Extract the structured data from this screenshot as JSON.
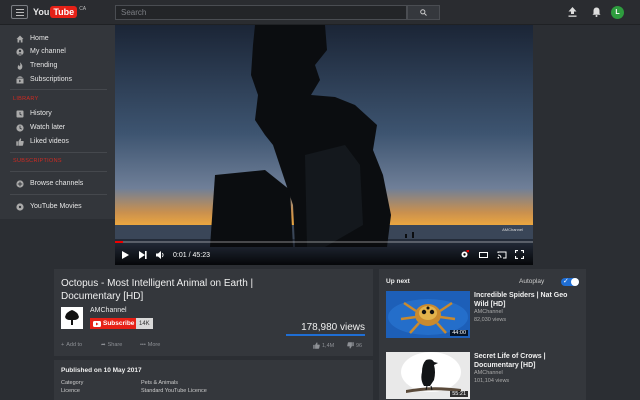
{
  "topbar": {
    "logo_you": "You",
    "logo_tube": "Tube",
    "logo_country": "CA",
    "search_placeholder": "Search",
    "avatar_initial": "L"
  },
  "sidebar": {
    "items_top": [
      {
        "label": "Home",
        "icon": "home-icon"
      },
      {
        "label": "My channel",
        "icon": "person-icon"
      },
      {
        "label": "Trending",
        "icon": "flame-icon"
      },
      {
        "label": "Subscriptions",
        "icon": "subscriptions-icon"
      }
    ],
    "library_heading": "LIBRARY",
    "items_library": [
      {
        "label": "History",
        "icon": "history-icon"
      },
      {
        "label": "Watch later",
        "icon": "clock-icon"
      },
      {
        "label": "Liked videos",
        "icon": "thumbs-up-icon"
      }
    ],
    "subscriptions_heading": "SUBSCRIPTIONS",
    "items_bottom": [
      {
        "label": "Browse channels",
        "icon": "plus-circle-icon"
      },
      {
        "label": "YouTube Movies",
        "icon": "film-icon"
      }
    ]
  },
  "player": {
    "time_current": "0:01",
    "time_total": "45:23",
    "time_separator": "/",
    "progress_fraction": 0.02,
    "watermark": "AMChannel"
  },
  "video": {
    "title": "Octopus - Most Intelligent Animal on Earth | Documentary [HD]",
    "channel": "AMChannel",
    "subscribe_label": "Subscribe",
    "subscriber_count": "14K",
    "views": "178,980 views",
    "actions": {
      "add_to": "Add to",
      "share": "Share",
      "more": "More",
      "like": "1,4M",
      "dislike": "96"
    },
    "published": "Published on 10 May 2017",
    "meta": [
      {
        "key": "Category",
        "value": "Pets & Animals"
      },
      {
        "key": "Licence",
        "value": "Standard YouTube Licence"
      }
    ]
  },
  "upnext": {
    "label": "Up next",
    "autoplay_label": "Autoplay",
    "autoplay_on": true,
    "items": [
      {
        "title": "Incredible Spiders | Nat Geo Wild [HD]",
        "channel": "AMChannel",
        "views": "82,030 views",
        "duration": "44:00"
      },
      {
        "title": "Secret Life of Crows | Documentary [HD]",
        "channel": "AMChannel",
        "views": "101,104 views",
        "duration": "55:21"
      }
    ]
  },
  "colors": {
    "accent_red": "#e62117",
    "accent_blue": "#1f6ed4",
    "avatar_green": "#2e9c3e"
  }
}
